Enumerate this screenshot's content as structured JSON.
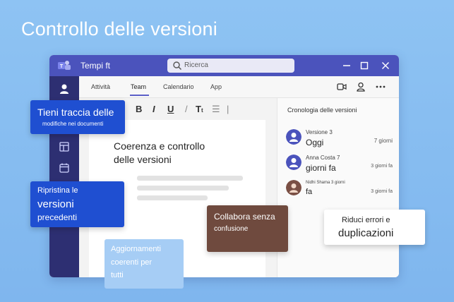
{
  "headline": "Controllo delle versioni",
  "app": {
    "title": "Tempi ft",
    "search_placeholder": "Ricerca"
  },
  "tabs": [
    {
      "label": "Attività"
    },
    {
      "label": "Team"
    },
    {
      "label": "Calendario"
    },
    {
      "label": "App"
    }
  ],
  "active_tab": "Team",
  "document": {
    "title_line1": "Coerenza e controllo",
    "title_line2": "delle versioni"
  },
  "history": {
    "title": "Cronologia delle versioni",
    "items": [
      {
        "name": "Versione 3",
        "subtitle": "Oggi",
        "date": "7 giorni"
      },
      {
        "name": "Anna Costa 7",
        "subtitle": "giorni fa",
        "date": "3 giorni fa"
      },
      {
        "name": "Nidhi Shama 3 giorni",
        "subtitle": "fa",
        "date": "3 giorni fa"
      }
    ]
  },
  "callouts": {
    "track_line1": "Tieni traccia delle",
    "track_line2": "modifiche nei documenti",
    "restore_line1": "Ripristina le",
    "restore_line2": "versioni",
    "restore_line3": "precedenti",
    "collab_line1": "Collabora senza",
    "collab_line2": "confusione",
    "updates_line1": "Aggiornamenti",
    "updates_line2": "coerenti per",
    "updates_line3": "tutti",
    "reduce_line1": "Riduci errori e",
    "reduce_line2": "duplicazioni"
  },
  "colors": {
    "background": "#8ec3f3",
    "titlebar": "#4b53bc",
    "rail": "#2d2f72",
    "callout_blue": "#1f4fd1",
    "callout_brown": "#6f4a3e"
  },
  "icons": [
    "teams-logo-icon",
    "search-icon",
    "minimize-icon",
    "maximize-icon",
    "close-icon",
    "avatar-icon",
    "calendar-icon",
    "video-icon",
    "person-icon",
    "more-icon"
  ]
}
